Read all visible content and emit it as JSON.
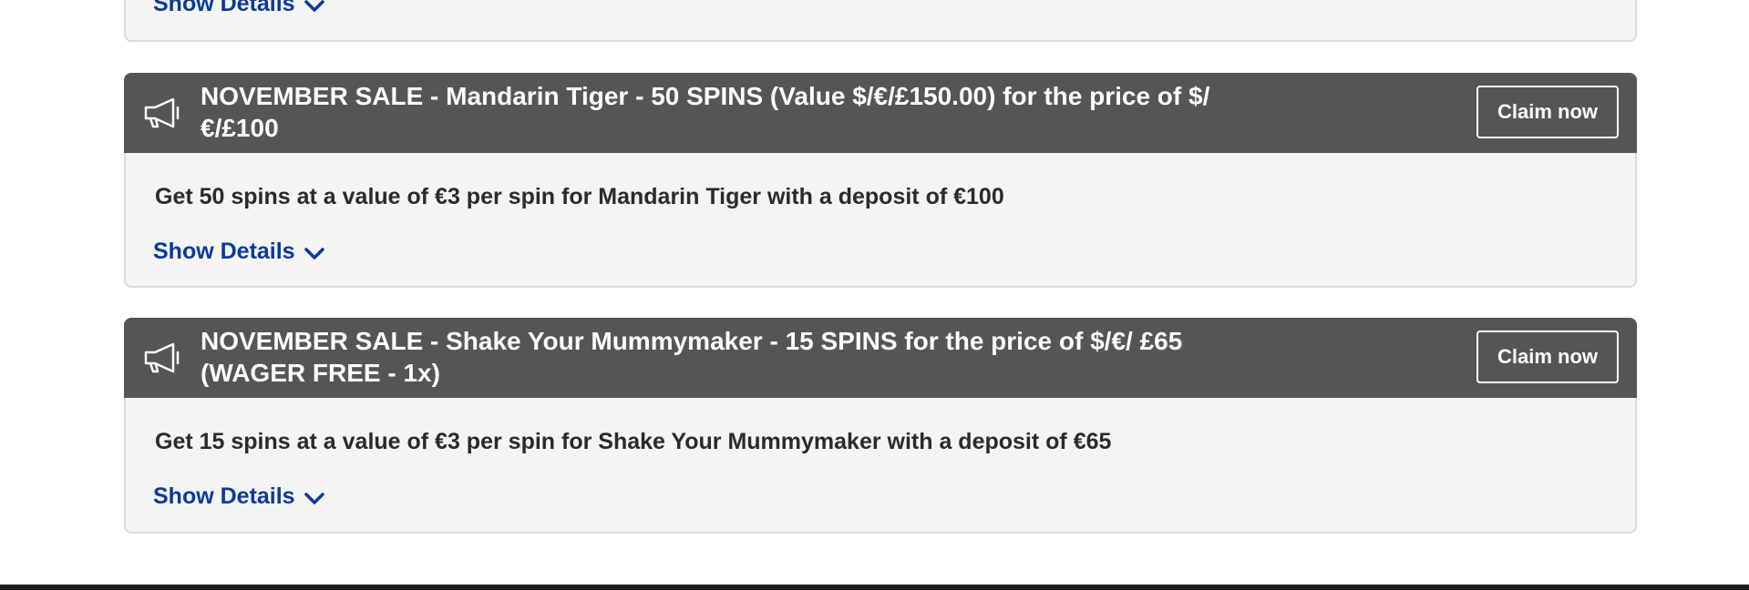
{
  "top_card": {
    "show_details_label": "Show Details"
  },
  "promotions": [
    {
      "title": "NOVEMBER SALE - Mandarin Tiger - 50 SPINS (Value $/€/£150.00) for the price of $/€/£100",
      "claim_label": "Claim now",
      "description": "Get 50 spins at a value of €3 per spin for Mandarin Tiger with a deposit of €100",
      "show_details_label": "Show Details"
    },
    {
      "title": "NOVEMBER SALE - Shake Your Mummymaker - 15 SPINS for the price of $/€/ £65 (WAGER FREE - 1x)",
      "claim_label": "Claim now",
      "description": "Get 15 spins at a value of €3 per spin for Shake Your Mummymaker with a deposit of €65",
      "show_details_label": "Show Details"
    }
  ],
  "icons": {
    "promo_icon": "megaphone-icon",
    "expand_icon": "chevron-down-icon"
  },
  "colors": {
    "header_bg": "#555555",
    "card_bg": "#f4f4f4",
    "link": "#0a3a9a"
  }
}
